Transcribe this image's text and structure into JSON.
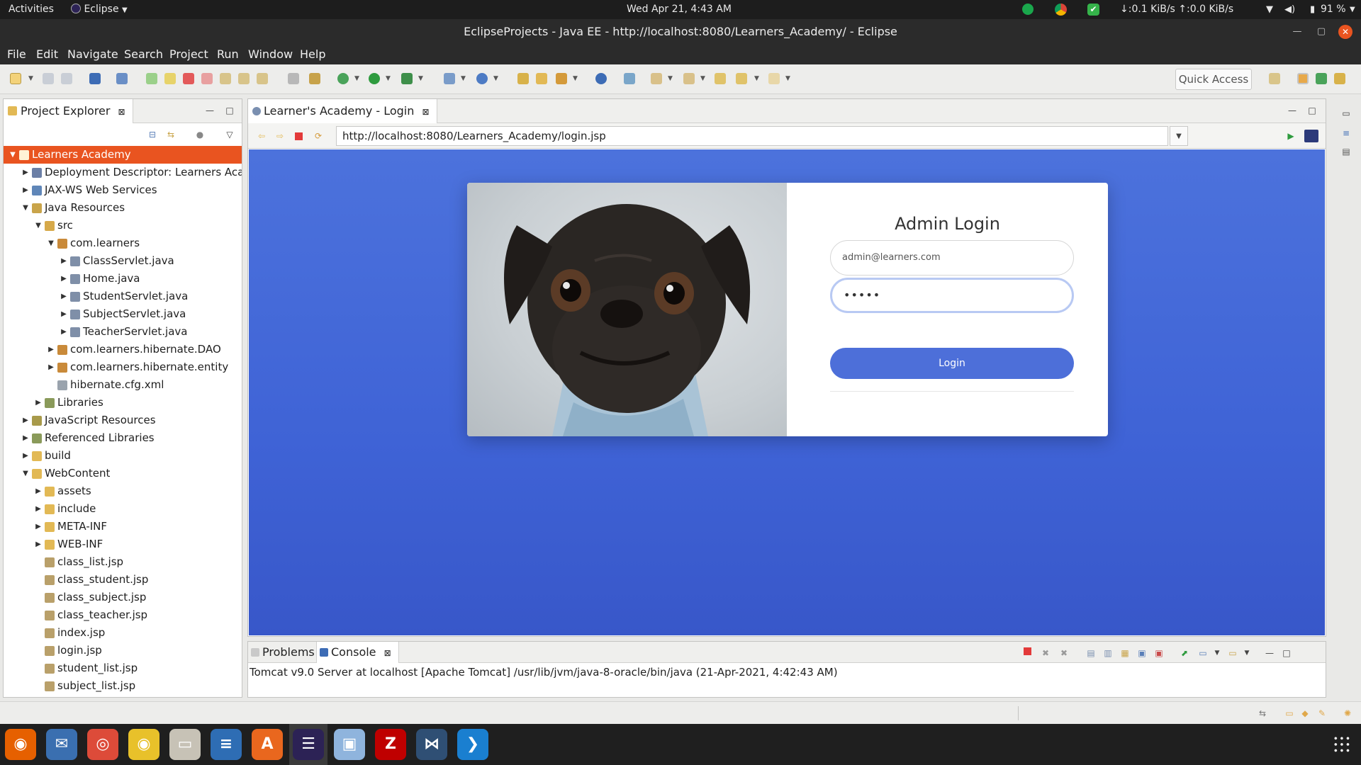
{
  "topbar": {
    "activities": "Activities",
    "app_menu": "Eclipse",
    "clock": "Wed Apr 21,  4:43 AM",
    "network_speed": "↓:0.1 KiB/s ↑:0.0 KiB/s",
    "battery": "91 %"
  },
  "window": {
    "title": "EclipseProjects - Java EE - http://localhost:8080/Learners_Academy/ - Eclipse"
  },
  "menu": [
    "File",
    "Edit",
    "Navigate",
    "Search",
    "Project",
    "Run",
    "Window",
    "Help"
  ],
  "toolbar": {
    "quick_access": "Quick Access"
  },
  "explorer": {
    "tab_label": "Project Explorer",
    "tree": [
      {
        "label": "Learners Academy",
        "depth": 0,
        "twisty": "open",
        "selected": true,
        "icon": "project-icon",
        "color": "#fff3d6"
      },
      {
        "label": "Deployment Descriptor: Learners Acad",
        "depth": 1,
        "twisty": "closed",
        "icon": "descriptor-icon",
        "color": "#6b7fa6"
      },
      {
        "label": "JAX-WS Web Services",
        "depth": 1,
        "twisty": "closed",
        "icon": "webservice-icon",
        "color": "#5f86b8"
      },
      {
        "label": "Java Resources",
        "depth": 1,
        "twisty": "open",
        "icon": "java-resources-icon",
        "color": "#c9a44a"
      },
      {
        "label": "src",
        "depth": 2,
        "twisty": "open",
        "icon": "source-folder-icon",
        "color": "#d6a94a"
      },
      {
        "label": "com.learners",
        "depth": 3,
        "twisty": "open",
        "icon": "package-icon",
        "color": "#c98a3a"
      },
      {
        "label": "ClassServlet.java",
        "depth": 4,
        "twisty": "closed",
        "icon": "java-file-icon",
        "color": "#7f8fa8"
      },
      {
        "label": "Home.java",
        "depth": 4,
        "twisty": "closed",
        "icon": "java-file-icon",
        "color": "#7f8fa8"
      },
      {
        "label": "StudentServlet.java",
        "depth": 4,
        "twisty": "closed",
        "icon": "java-file-icon",
        "color": "#7f8fa8"
      },
      {
        "label": "SubjectServlet.java",
        "depth": 4,
        "twisty": "closed",
        "icon": "java-file-icon",
        "color": "#7f8fa8"
      },
      {
        "label": "TeacherServlet.java",
        "depth": 4,
        "twisty": "closed",
        "icon": "java-file-icon",
        "color": "#7f8fa8"
      },
      {
        "label": "com.learners.hibernate.DAO",
        "depth": 3,
        "twisty": "closed",
        "icon": "package-icon",
        "color": "#c98a3a"
      },
      {
        "label": "com.learners.hibernate.entity",
        "depth": 3,
        "twisty": "closed",
        "icon": "package-icon",
        "color": "#c98a3a"
      },
      {
        "label": "hibernate.cfg.xml",
        "depth": 3,
        "twisty": "none",
        "icon": "xml-file-icon",
        "color": "#9aa3ad"
      },
      {
        "label": "Libraries",
        "depth": 2,
        "twisty": "closed",
        "icon": "libraries-icon",
        "color": "#8a9a5a"
      },
      {
        "label": "JavaScript Resources",
        "depth": 1,
        "twisty": "closed",
        "icon": "js-resources-icon",
        "color": "#a89a4a"
      },
      {
        "label": "Referenced Libraries",
        "depth": 1,
        "twisty": "closed",
        "icon": "libraries-icon",
        "color": "#8a9a5a"
      },
      {
        "label": "build",
        "depth": 1,
        "twisty": "closed",
        "icon": "folder-icon",
        "color": "#e2b955"
      },
      {
        "label": "WebContent",
        "depth": 1,
        "twisty": "open",
        "icon": "folder-icon",
        "color": "#e2b955"
      },
      {
        "label": "assets",
        "depth": 2,
        "twisty": "closed",
        "icon": "folder-icon",
        "color": "#e2b955"
      },
      {
        "label": "include",
        "depth": 2,
        "twisty": "closed",
        "icon": "folder-icon",
        "color": "#e2b955"
      },
      {
        "label": "META-INF",
        "depth": 2,
        "twisty": "closed",
        "icon": "folder-icon",
        "color": "#e2b955"
      },
      {
        "label": "WEB-INF",
        "depth": 2,
        "twisty": "closed",
        "icon": "folder-icon",
        "color": "#e2b955"
      },
      {
        "label": "class_list.jsp",
        "depth": 2,
        "twisty": "none",
        "icon": "jsp-file-icon",
        "color": "#b9a06a"
      },
      {
        "label": "class_student.jsp",
        "depth": 2,
        "twisty": "none",
        "icon": "jsp-file-icon",
        "color": "#b9a06a"
      },
      {
        "label": "class_subject.jsp",
        "depth": 2,
        "twisty": "none",
        "icon": "jsp-file-icon",
        "color": "#b9a06a"
      },
      {
        "label": "class_teacher.jsp",
        "depth": 2,
        "twisty": "none",
        "icon": "jsp-file-icon",
        "color": "#b9a06a"
      },
      {
        "label": "index.jsp",
        "depth": 2,
        "twisty": "none",
        "icon": "jsp-file-icon",
        "color": "#b9a06a"
      },
      {
        "label": "login.jsp",
        "depth": 2,
        "twisty": "none",
        "icon": "jsp-file-icon",
        "color": "#b9a06a"
      },
      {
        "label": "student_list.jsp",
        "depth": 2,
        "twisty": "none",
        "icon": "jsp-file-icon",
        "color": "#b9a06a"
      },
      {
        "label": "subject_list.jsp",
        "depth": 2,
        "twisty": "none",
        "icon": "jsp-file-icon",
        "color": "#b9a06a"
      }
    ]
  },
  "editor": {
    "tab_label": "Learner's Academy - Login",
    "url": "http://localhost:8080/Learners_Academy/login.jsp"
  },
  "login_page": {
    "title": "Admin Login",
    "email_value": "admin@learners.com",
    "password_masked": "•••••",
    "login_button": "Login"
  },
  "console": {
    "problems_tab": "Problems",
    "console_tab": "Console",
    "output": "Tomcat v9.0 Server at localhost [Apache Tomcat] /usr/lib/jvm/java-8-oracle/bin/java (21-Apr-2021, 4:42:43 AM)"
  },
  "dock": [
    {
      "name": "firefox-icon",
      "color": "#e66000",
      "glyph": "◉"
    },
    {
      "name": "thunderbird-icon",
      "color": "#3a6fb0",
      "glyph": "✉"
    },
    {
      "name": "chrome-icon",
      "color": "#dd4b39",
      "glyph": "◎"
    },
    {
      "name": "rhythmbox-icon",
      "color": "#e8c12a",
      "glyph": "◉"
    },
    {
      "name": "files-icon",
      "color": "#c7c2b6",
      "glyph": "▭"
    },
    {
      "name": "writer-icon",
      "color": "#2e6db4",
      "glyph": "≡"
    },
    {
      "name": "software-center-icon",
      "color": "#e9671e",
      "glyph": "A"
    },
    {
      "name": "eclipse-icon",
      "color": "#2c2255",
      "glyph": "☰"
    },
    {
      "name": "virtualbox-icon",
      "color": "#8fb4dd",
      "glyph": "▣"
    },
    {
      "name": "filezilla-icon",
      "color": "#bf0000",
      "glyph": "Z"
    },
    {
      "name": "mysql-workbench-icon",
      "color": "#2f4f74",
      "glyph": "⋈"
    },
    {
      "name": "vscode-icon",
      "color": "#1a7fd0",
      "glyph": "❯"
    }
  ]
}
